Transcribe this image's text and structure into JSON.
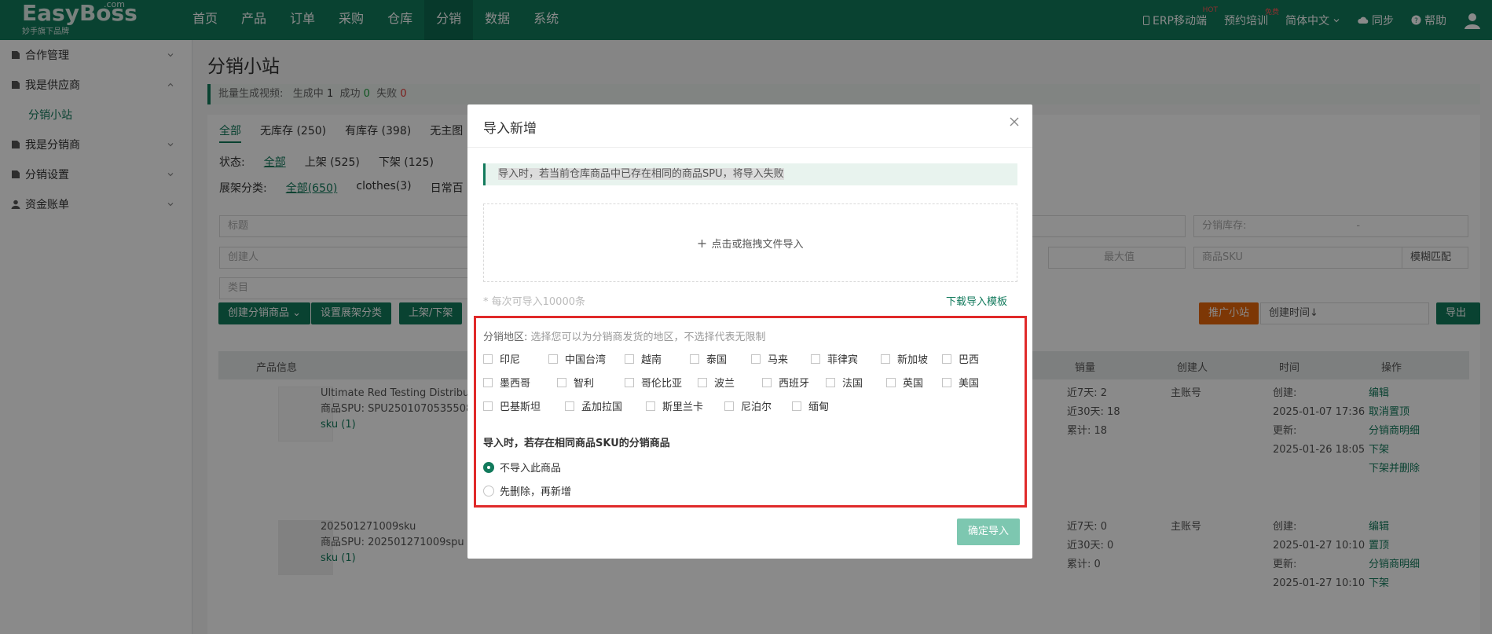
{
  "brand": {
    "name": "EasyBoss",
    "com": ".com",
    "slogan": "妙手旗下品牌"
  },
  "nav": {
    "items": [
      "首页",
      "产品",
      "订单",
      "采购",
      "仓库",
      "分销",
      "数据",
      "系统"
    ],
    "active_index": 5
  },
  "topbar": {
    "erp_mobile": "ERP移动端",
    "erp_badge": "HOT",
    "training": "预约培训",
    "training_badge": "免费",
    "language": "简体中文",
    "sync": "同步",
    "help": "帮助"
  },
  "sidebar": {
    "items": [
      {
        "label": "合作管理",
        "expanded": false
      },
      {
        "label": "我是供应商",
        "expanded": true
      },
      {
        "label": "我是分销商",
        "expanded": false
      },
      {
        "label": "分销设置",
        "expanded": false
      },
      {
        "label": "资金账单",
        "expanded": false
      }
    ],
    "active_sub": "分销小站"
  },
  "page": {
    "title": "分销小站",
    "video_bar": {
      "label": "批量生成视频:",
      "generating": "生成中",
      "generating_count": "1",
      "success": "成功",
      "success_count": "0",
      "fail": "失败",
      "fail_count": "0"
    },
    "tabs": [
      "全部",
      "无库存 (250)",
      "有库存 (398)",
      "无主图"
    ],
    "status_label": "状态:",
    "status_options": [
      "全部",
      "上架 (525)",
      "下架 (125)"
    ],
    "shelf_label": "展架分类:",
    "shelf_options": [
      "全部(650)",
      "clothes(3)",
      "日常百"
    ],
    "filters": {
      "title": "标题",
      "creator": "创建人",
      "category": "类目",
      "stock": "分销库存:",
      "stock_dash": "-",
      "max": "最大值",
      "sku": "商品SKU",
      "match": "模糊匹配"
    },
    "toolbar": {
      "create": "创建分销商品",
      "set_shelf": "设置展架分类",
      "on_off": "上架/下架",
      "promote": "推广小站",
      "sort": "创建时间↓",
      "export": "导出"
    },
    "table": {
      "headers": {
        "product": "产品信息",
        "sales": "销量",
        "creator": "创建人",
        "time": "时间",
        "ops": "操作"
      },
      "rows": [
        {
          "name": "Ultimate Red Testing Distribut",
          "spu": "商品SPU: SPU2501070535508",
          "sku": "sku (1)",
          "sales": [
            "近7天: 2",
            "近30天: 18",
            "累计: 18"
          ],
          "creator": "主账号",
          "time": [
            "创建:",
            "2025-01-07 17:36",
            "更新:",
            "2025-01-26 18:05"
          ],
          "ops": [
            "编辑",
            "取消置顶",
            "分销商明细",
            "下架",
            "下架并删除"
          ]
        },
        {
          "name": "202501271009sku",
          "spu": "商品SPU: 202501271009spu",
          "sku": "sku (1)",
          "sales": [
            "近7天: 0",
            "近30天: 0",
            "累计: 0"
          ],
          "creator": "主账号",
          "time": [
            "创建:",
            "2025-01-27 10:10",
            "更新:",
            "2025-01-27 10:10"
          ],
          "ops": [
            "编辑",
            "置顶",
            "分销商明细",
            "下架"
          ]
        }
      ]
    }
  },
  "modal": {
    "title": "导入新增",
    "warning": "导入时，若当前仓库商品中已存在相同的商品SPU，将导入失败",
    "upload_text": "点击或拖拽文件导入",
    "note": "* 每次可导入10000条",
    "download_link": "下载导入模板",
    "area_label": "分销地区:",
    "area_hint": "选择您可以为分销商发货的地区，不选择代表无限制",
    "regions": [
      [
        "印尼",
        "中国台湾",
        "越南",
        "泰国",
        "马来",
        "菲律宾",
        "新加坡",
        "巴西"
      ],
      [
        "墨西哥",
        "智利",
        "哥伦比亚",
        "波兰",
        "西班牙",
        "法国",
        "英国",
        "美国"
      ],
      [
        "巴基斯坦",
        "孟加拉国",
        "斯里兰卡",
        "尼泊尔",
        "缅甸"
      ]
    ],
    "sku_question": "导入时，若存在相同商品SKU的分销商品",
    "sku_options": [
      "不导入此商品",
      "先删除，再新增"
    ],
    "sku_selected": 0,
    "confirm": "确定导入"
  },
  "colors": {
    "primary": "#127a5c",
    "danger": "#e02a2a",
    "orange": "#e8660b"
  }
}
